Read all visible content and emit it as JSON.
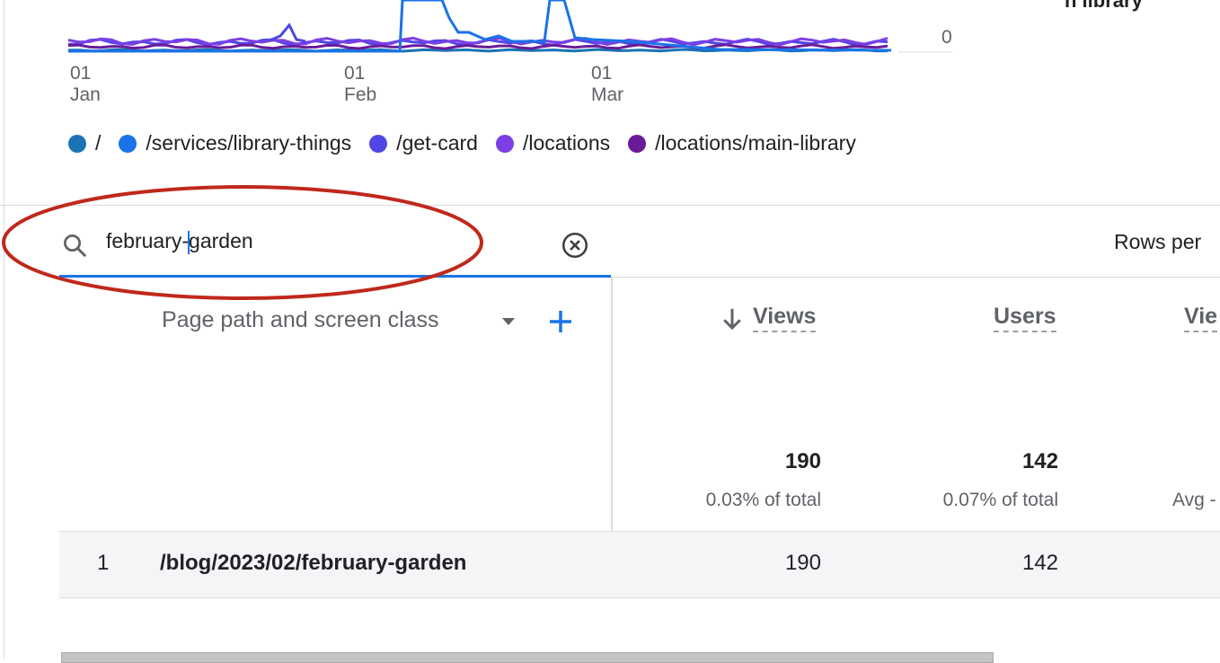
{
  "chart": {
    "y_tick": "0",
    "cut_label": "n library",
    "x_ticks": [
      {
        "day": "01",
        "month": "Jan"
      },
      {
        "day": "01",
        "month": "Feb"
      },
      {
        "day": "01",
        "month": "Mar"
      }
    ],
    "legend": [
      {
        "label": "/",
        "color": "#1a73b5"
      },
      {
        "label": "/services/library-things",
        "color": "#1a73e8"
      },
      {
        "label": "/get-card",
        "color": "#4f46e5"
      },
      {
        "label": "/locations",
        "color": "#7b3fe4"
      },
      {
        "label": "/locations/main-library",
        "color": "#6a1b9a"
      }
    ]
  },
  "search": {
    "value_before_caret": "february-",
    "value_after_caret": "garden",
    "annotation_color": "#c0281c"
  },
  "rows_per_page_label": "Rows per",
  "table": {
    "dimension_header": "Page path and screen class",
    "columns": [
      {
        "label": "Views",
        "total": "190",
        "total_sub": "0.03% of total",
        "sorted": true
      },
      {
        "label": "Users",
        "total": "142",
        "total_sub": "0.07% of total"
      },
      {
        "label": "Vie",
        "total": "",
        "total_sub": "Avg -"
      }
    ],
    "rows": [
      {
        "num": "1",
        "path": "/blog/2023/02/february-garden",
        "views": "190",
        "users": "142"
      }
    ]
  },
  "icons": {
    "search": "search-icon",
    "clear": "clear-circle-icon",
    "dropdown": "dropdown-arrow-icon",
    "add": "plus-icon",
    "sort": "arrow-down-icon"
  }
}
